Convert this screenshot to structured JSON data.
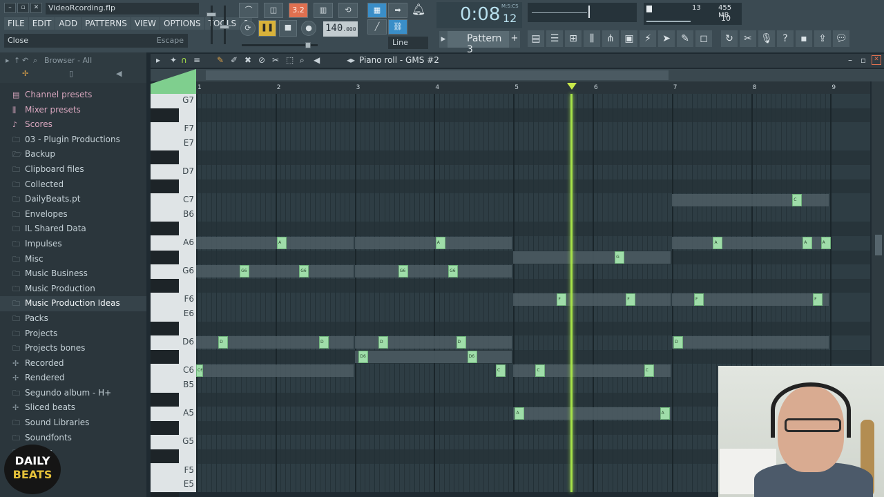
{
  "window": {
    "project_file": "VideoRcording.flp"
  },
  "menu": [
    "FILE",
    "EDIT",
    "ADD",
    "PATTERNS",
    "VIEW",
    "OPTIONS",
    "TOOLS",
    "?"
  ],
  "hint": {
    "text": "Close",
    "shortcut": "Escape"
  },
  "transport": {
    "tempo": "140",
    "tempo_frac": ".000",
    "time": "0:08",
    "time_sec": "12",
    "time_unit": "M:S:CS",
    "mode_badge": "3.2",
    "snap": "Line",
    "pattern": "Pattern 3",
    "pattern_add": "+"
  },
  "cpu": {
    "value1": "13",
    "memory": "455 MB",
    "polyphony": "10"
  },
  "browser": {
    "title": "Browser - All",
    "items": [
      {
        "label": "Channel presets",
        "icon": "preset-icon"
      },
      {
        "label": "Mixer presets",
        "icon": "mixer-icon"
      },
      {
        "label": "Scores",
        "icon": "note-icon"
      },
      {
        "label": "03 - Plugin Productions",
        "icon": "folder-icon"
      },
      {
        "label": "Backup",
        "icon": "backup-icon"
      },
      {
        "label": "Clipboard files",
        "icon": "folder-icon"
      },
      {
        "label": "Collected",
        "icon": "folder-icon"
      },
      {
        "label": "DailyBeats.pt",
        "icon": "folder-icon"
      },
      {
        "label": "Envelopes",
        "icon": "folder-icon"
      },
      {
        "label": "IL Shared Data",
        "icon": "folder-icon"
      },
      {
        "label": "Impulses",
        "icon": "folder-icon"
      },
      {
        "label": "Misc",
        "icon": "folder-icon"
      },
      {
        "label": "Music Business",
        "icon": "folder-icon"
      },
      {
        "label": "Music Production",
        "icon": "folder-icon"
      },
      {
        "label": "Music Production Ideas",
        "icon": "folder-icon"
      },
      {
        "label": "Packs",
        "icon": "folder-icon"
      },
      {
        "label": "Projects",
        "icon": "folder-icon"
      },
      {
        "label": "Projects bones",
        "icon": "folder-icon"
      },
      {
        "label": "Recorded",
        "icon": "plus-icon"
      },
      {
        "label": "Rendered",
        "icon": "plus-icon"
      },
      {
        "label": "Segundo album - H+",
        "icon": "folder-icon"
      },
      {
        "label": "Sliced beats",
        "icon": "plus-icon"
      },
      {
        "label": "Sound Libraries",
        "icon": "folder-icon"
      },
      {
        "label": "Soundfonts",
        "icon": "folder-icon"
      },
      {
        "label": "Videos",
        "icon": "folder-icon"
      }
    ],
    "selected_index": 14,
    "logo_line1": "DAILY",
    "logo_line2": "BEATS"
  },
  "piano_roll": {
    "title": "Piano roll - GMS #2",
    "bars": [
      "1",
      "2",
      "3",
      "4",
      "5",
      "6",
      "7",
      "8",
      "9"
    ],
    "key_labels": [
      "G7",
      "F7",
      "E7",
      "D7",
      "C7",
      "B6",
      "A6",
      "G6",
      "F6",
      "E6",
      "D6",
      "C6",
      "B5",
      "A5",
      "G5",
      "F5",
      "E5"
    ],
    "playhead_bar": 5.72,
    "notes": [
      {
        "label": "C6",
        "bar": 1.0,
        "len": 2.0,
        "key": "C6"
      },
      {
        "label": "D",
        "bar": 1.28,
        "len": 0.0,
        "key": "D6"
      },
      {
        "label": "G6",
        "bar": 1.55,
        "len": 0.0,
        "key": "G6"
      },
      {
        "label": "A",
        "bar": 2.02,
        "len": 0.0,
        "key": "A6"
      },
      {
        "label": "G6",
        "bar": 2.3,
        "len": 0.0,
        "key": "G6"
      },
      {
        "label": "D",
        "bar": 2.55,
        "len": 0.0,
        "key": "D6"
      },
      {
        "label": "D6",
        "bar": 3.05,
        "len": 0.0,
        "key": "C#6"
      },
      {
        "label": "D",
        "bar": 3.3,
        "len": 0.0,
        "key": "D6"
      },
      {
        "label": "G6",
        "bar": 3.55,
        "len": 0.0,
        "key": "G6"
      },
      {
        "label": "A",
        "bar": 4.02,
        "len": 0.0,
        "key": "A6"
      },
      {
        "label": "G6",
        "bar": 4.18,
        "len": 0.0,
        "key": "G6"
      },
      {
        "label": "D",
        "bar": 4.28,
        "len": 0.0,
        "key": "D6"
      },
      {
        "label": "D6",
        "bar": 4.42,
        "len": 0.0,
        "key": "C#6"
      },
      {
        "label": "C",
        "bar": 4.78,
        "len": 0.0,
        "key": "C6"
      },
      {
        "label": "A",
        "bar": 5.02,
        "len": 0.0,
        "key": "A5"
      },
      {
        "label": "C",
        "bar": 5.28,
        "len": 0.0,
        "key": "C6"
      },
      {
        "label": "F",
        "bar": 5.55,
        "len": 0.0,
        "key": "F6"
      },
      {
        "label": "G",
        "bar": 6.28,
        "len": 0.0,
        "key": "G#6"
      },
      {
        "label": "F",
        "bar": 6.42,
        "len": 0.0,
        "key": "F6"
      },
      {
        "label": "C",
        "bar": 6.65,
        "len": 0.0,
        "key": "C6"
      },
      {
        "label": "A",
        "bar": 6.85,
        "len": 0.0,
        "key": "A5"
      },
      {
        "label": "D",
        "bar": 7.02,
        "len": 0.0,
        "key": "D6"
      },
      {
        "label": "F",
        "bar": 7.28,
        "len": 0.0,
        "key": "F6"
      },
      {
        "label": "A",
        "bar": 7.52,
        "len": 0.0,
        "key": "A6"
      },
      {
        "label": "A",
        "bar": 8.65,
        "len": 0.0,
        "key": "A6"
      },
      {
        "label": "C",
        "bar": 8.52,
        "len": 0.0,
        "key": "C7"
      },
      {
        "label": "F",
        "bar": 8.78,
        "len": 0.0,
        "key": "F6"
      },
      {
        "label": "A",
        "bar": 8.88,
        "len": 0.0,
        "key": "A6"
      }
    ]
  },
  "colors": {
    "note": "#9fdda9",
    "playhead": "#a6e24a",
    "accent": "#e07050"
  }
}
